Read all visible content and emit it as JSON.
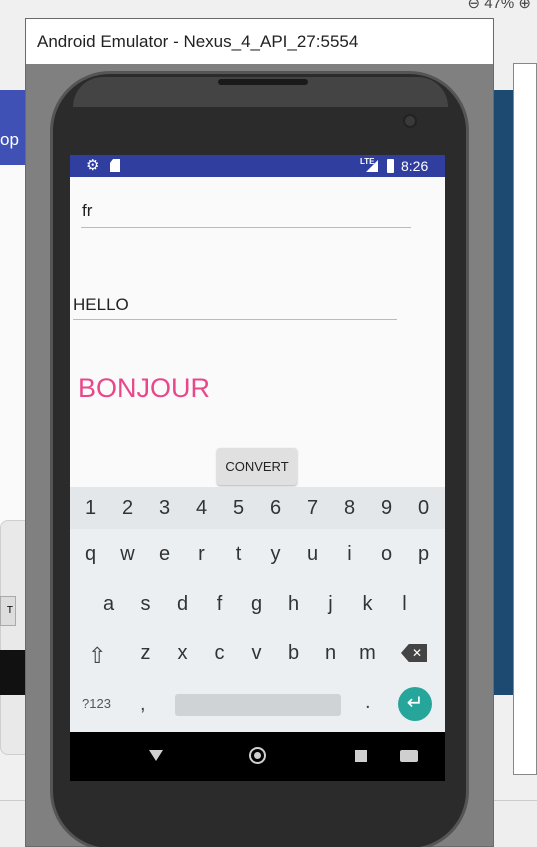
{
  "ide": {
    "zoom_label": "⊖ 47% ⊕",
    "left_tab_label": "op",
    "left_dialog_button": "T"
  },
  "emulator": {
    "window_title": "Android Emulator - Nexus_4_API_27:5554"
  },
  "status_bar": {
    "time": "8:26",
    "network_label": "LTE"
  },
  "app": {
    "language_value": "fr",
    "word_value": "HELLO",
    "translation_text": "BONJOUR",
    "convert_label": "CONVERT"
  },
  "keyboard": {
    "number_row": [
      "1",
      "2",
      "3",
      "4",
      "5",
      "6",
      "7",
      "8",
      "9",
      "0"
    ],
    "row1": [
      "q",
      "w",
      "e",
      "r",
      "t",
      "y",
      "u",
      "i",
      "o",
      "p"
    ],
    "row2": [
      "a",
      "s",
      "d",
      "f",
      "g",
      "h",
      "j",
      "k",
      "l"
    ],
    "row3": [
      "z",
      "x",
      "c",
      "v",
      "b",
      "n",
      "m"
    ],
    "symbols_label": "?123",
    "comma": ",",
    "period": "."
  },
  "colors": {
    "status_bar": "#303f9f",
    "accent_pink": "#e8488b",
    "enter_key": "#26a69a"
  }
}
